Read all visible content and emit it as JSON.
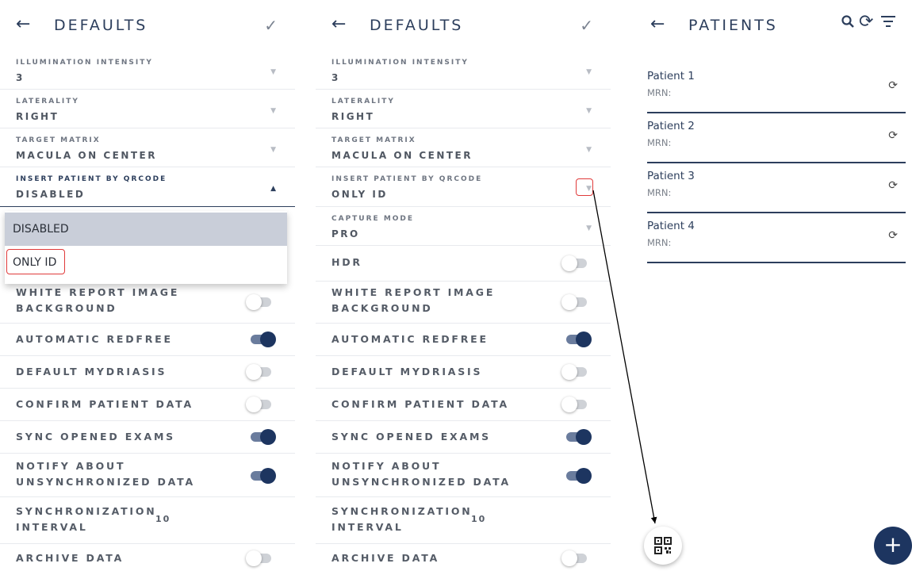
{
  "left_panel": {
    "back_icon": "arrow-left-icon",
    "title": "DEFAULTS",
    "check_icon": "check-icon",
    "settings": [
      {
        "label": "ILLUMINATION INTENSITY",
        "value": "3"
      },
      {
        "label": "LATERALITY",
        "value": "RIGHT"
      },
      {
        "label": "TARGET MATRIX",
        "value": "MACULA ON CENTER"
      },
      {
        "label": "INSERT PATIENT BY QRCODE",
        "value": "DISABLED"
      }
    ],
    "dropdown_options": [
      "DISABLED",
      "ONLY ID"
    ],
    "toggles": [
      {
        "label_line1": "WHITE REPORT IMAGE",
        "label_line2": "BACKGROUND",
        "on": false
      },
      {
        "label_line1": "AUTOMATIC REDFREE",
        "on": true
      },
      {
        "label_line1": "DEFAULT MYDRIASIS",
        "on": false
      },
      {
        "label_line1": "CONFIRM PATIENT DATA",
        "on": false
      },
      {
        "label_line1": "SYNC OPENED EXAMS",
        "on": true
      },
      {
        "label_line1": "NOTIFY ABOUT",
        "label_line2": "UNSYNCHRONIZED DATA",
        "on": true
      }
    ],
    "sync_interval": {
      "label_line1": "SYNCHRONIZATION",
      "label_line2": "INTERVAL",
      "value": "10"
    },
    "archive": {
      "label": "ARCHIVE DATA",
      "on": false
    }
  },
  "middle_panel": {
    "title": "DEFAULTS",
    "settings": [
      {
        "label": "ILLUMINATION INTENSITY",
        "value": "3"
      },
      {
        "label": "LATERALITY",
        "value": "RIGHT"
      },
      {
        "label": "TARGET MATRIX",
        "value": "MACULA ON CENTER"
      },
      {
        "label": "INSERT PATIENT BY QRCODE",
        "value": "ONLY ID"
      },
      {
        "label": "CAPTURE MODE",
        "value": "PRO"
      }
    ],
    "toggles": [
      {
        "label_line1": "HDR",
        "on": false
      },
      {
        "label_line1": "WHITE REPORT IMAGE",
        "label_line2": "BACKGROUND",
        "on": false
      },
      {
        "label_line1": "AUTOMATIC REDFREE",
        "on": true
      },
      {
        "label_line1": "DEFAULT MYDRIASIS",
        "on": false
      },
      {
        "label_line1": "CONFIRM PATIENT DATA",
        "on": false
      },
      {
        "label_line1": "SYNC OPENED EXAMS",
        "on": true
      },
      {
        "label_line1": "NOTIFY ABOUT",
        "label_line2": "UNSYNCHRONIZED DATA",
        "on": true
      }
    ],
    "sync_interval": {
      "label_line1": "SYNCHRONIZATION",
      "label_line2": "INTERVAL",
      "value": "10"
    },
    "archive": {
      "label": "ARCHIVE DATA",
      "on": false
    }
  },
  "right_panel": {
    "title": "PATIENTS",
    "header_icons": [
      "search-icon",
      "sync-icon",
      "filter-icon"
    ],
    "patients": [
      {
        "name": "Patient 1",
        "mrn": "MRN:"
      },
      {
        "name": "Patient 2",
        "mrn": "MRN:"
      },
      {
        "name": "Patient 3",
        "mrn": "MRN:"
      },
      {
        "name": "Patient 4",
        "mrn": "MRN:"
      }
    ],
    "qr_fab_icon": "qr-code-icon",
    "add_fab_icon": "plus-icon"
  },
  "colors": {
    "accent": "#1d3560",
    "highlight": "#e03a3a",
    "selected_option": "#c9ced9"
  }
}
